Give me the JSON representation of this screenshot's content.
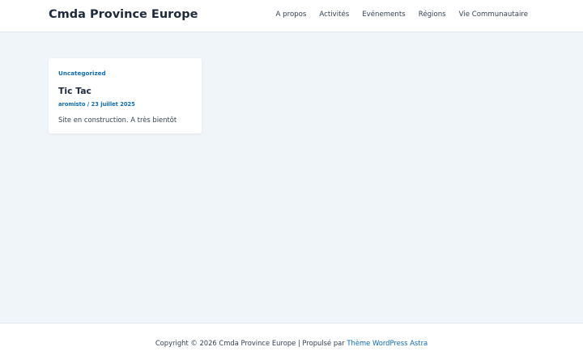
{
  "header": {
    "site_title": "Cmda Province Europe",
    "nav": [
      {
        "label": "A propos"
      },
      {
        "label": "Activités"
      },
      {
        "label": "Evénements"
      },
      {
        "label": "Régions"
      },
      {
        "label": "Vie Communautaire"
      }
    ]
  },
  "post": {
    "category": "Uncategorized",
    "title": "Tic Tac",
    "author": "aromisto",
    "separator": "/",
    "date": "23 juillet 2025",
    "excerpt": "Site en construction. A très bientôt"
  },
  "footer": {
    "copyright_text": "Copyright © 2026 Cmda Province Europe | Propulsé par",
    "theme_link": "Thème WordPress Astra"
  },
  "colors": {
    "accent": "#0b6bb5",
    "background": "#f0f5fa",
    "text": "#1e293b"
  }
}
